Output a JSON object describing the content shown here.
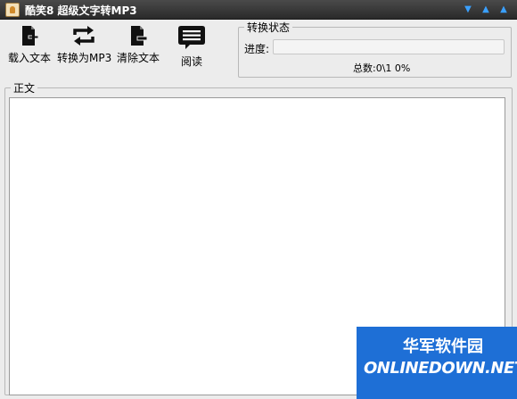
{
  "window": {
    "title": "酷笑8 超级文字转MP3",
    "controls": [
      "chevron-down-icon",
      "chevron-up-icon",
      "chevron-up-icon"
    ]
  },
  "toolbar": {
    "load_label": "载入文本",
    "convert_label": "转换为MP3",
    "clear_label": "清除文本",
    "read_label": "阅读"
  },
  "status": {
    "group_title": "转换状态",
    "progress_label": "进度:",
    "progress_fraction": 0,
    "total_text": "总数:0\\1 0%"
  },
  "content": {
    "group_title": "正文",
    "text_value": ""
  },
  "watermark": {
    "cn_text": "华军软件园",
    "en_text": "ONLINEDOWN.NET"
  },
  "colors": {
    "titlebar": "#2f2f2f",
    "accent": "#3aa0ff",
    "watermark_bg": "#1e6fd6"
  }
}
